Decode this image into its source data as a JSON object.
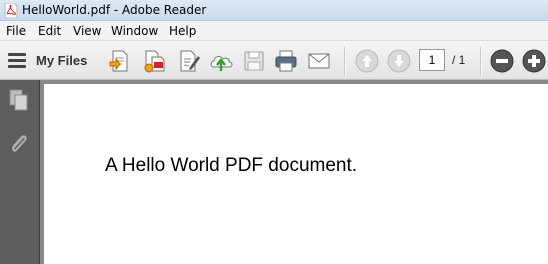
{
  "window": {
    "title": "HelloWorld.pdf - Adobe Reader"
  },
  "menu": {
    "items": [
      "File",
      "Edit",
      "View",
      "Window",
      "Help"
    ]
  },
  "toolbar": {
    "my_files_label": "My Files",
    "page_current": "1",
    "page_total": "/ 1",
    "icons": [
      "menu-icon",
      "create-pdf-icon",
      "combine-files-icon",
      "sign-icon",
      "upload-cloud-icon",
      "save-icon",
      "print-icon",
      "email-icon",
      "previous-page-icon",
      "next-page-icon",
      "zoom-out-icon",
      "zoom-in-icon"
    ]
  },
  "sidebar": {
    "icons": [
      "page-thumbnails-icon",
      "attachments-icon"
    ]
  },
  "document": {
    "text": "A Hello World PDF document."
  },
  "colors": {
    "sidebar": "#5d5d5d",
    "page_background": "#8a8a8a",
    "adobe_red": "#d2232a"
  }
}
